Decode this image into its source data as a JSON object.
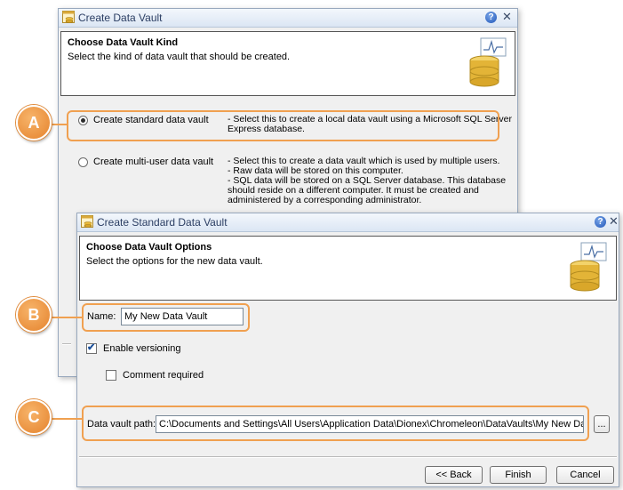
{
  "dialog1": {
    "title": "Create Data Vault",
    "header_title": "Choose Data Vault Kind",
    "header_subtitle": "Select the kind of data vault that should be created.",
    "option_standard": {
      "label": "Create standard data vault",
      "selected": true,
      "description": [
        "- Select this to create a local data vault using a Microsoft SQL Server",
        "Express database."
      ]
    },
    "option_multiuser": {
      "label": "Create multi-user data vault",
      "selected": false,
      "description": [
        "- Select this to create a data vault which is used by multiple users.",
        "- Raw data will be stored on this computer.",
        "- SQL data will be stored on a SQL Server database. This database",
        "should reside on a different computer. It must be created and",
        "administered by a corresponding administrator."
      ]
    }
  },
  "dialog2": {
    "title": "Create Standard Data Vault",
    "header_title": "Choose Data Vault Options",
    "header_subtitle": "Select the options for the new data vault.",
    "name_label": "Name:",
    "name_value": "My New Data Vault",
    "versioning_label": "Enable versioning",
    "versioning_checked": true,
    "comment_label": "Comment required",
    "comment_checked": false,
    "path_label": "Data vault path:",
    "path_value": "C:\\Documents and Settings\\All Users\\Application Data\\Dionex\\Chromeleon\\DataVaults\\My New Data Vault",
    "browse_label": "...",
    "back_label": "<< Back",
    "finish_label": "Finish",
    "cancel_label": "Cancel"
  },
  "callouts": {
    "a": "A",
    "b": "B",
    "c": "C"
  },
  "icons": {
    "window_icon": "database-window-icon",
    "help": "help-icon",
    "close": "close-icon",
    "header_graphic": "database-chart-icon"
  },
  "colors": {
    "callout": "#f0a050",
    "title_text": "#2b3e63"
  }
}
